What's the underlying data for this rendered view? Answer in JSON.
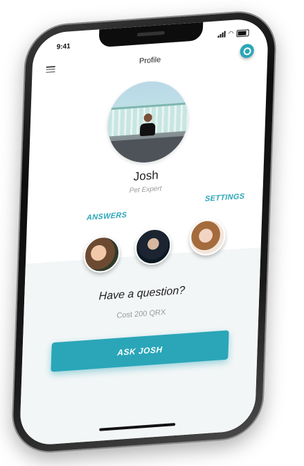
{
  "status_bar": {
    "time": "9:41"
  },
  "nav": {
    "title": "Profile"
  },
  "profile": {
    "name": "Josh",
    "role": "Pet Expert"
  },
  "links": {
    "answers": "ANSWERS",
    "settings": "SETTINGS"
  },
  "cta": {
    "question": "Have a question?",
    "cost": "Cost 200 QRX",
    "button": "ASK JOSH"
  },
  "colors": {
    "accent": "#2aa6b8"
  }
}
